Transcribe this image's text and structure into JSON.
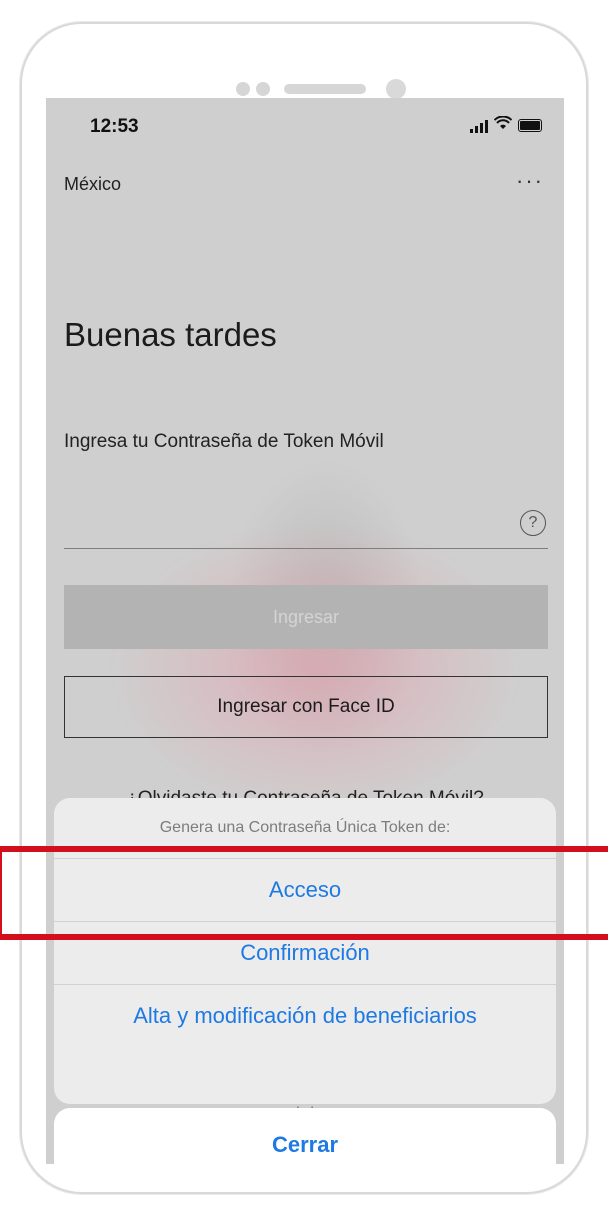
{
  "status_bar": {
    "time": "12:53"
  },
  "header": {
    "country": "México",
    "more_label": "···"
  },
  "main": {
    "greeting": "Buenas tardes",
    "password_prompt": "Ingresa tu Contraseña de Token Móvil",
    "help_label": "?",
    "login_button": "Ingresar",
    "face_id_button": "Ingresar con Face ID",
    "forgot_link": "¿Olvidaste tu Contraseña de Token Móvil?"
  },
  "action_sheet": {
    "title": "Genera una Contraseña Única Token de:",
    "options": [
      "Acceso",
      "Confirmación",
      "Alta y modificación de beneficiarios"
    ],
    "grip": "|:::|",
    "cancel": "Cerrar"
  },
  "colors": {
    "accent": "#1e7ae2",
    "highlight": "#d30f1d"
  }
}
